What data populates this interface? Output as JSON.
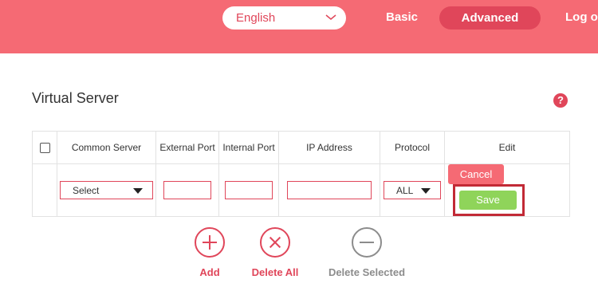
{
  "header": {
    "language": {
      "selected": "English",
      "icon": "chevron-down-icon"
    },
    "nav": {
      "basic": "Basic",
      "advanced": "Advanced",
      "logout": "Log ou"
    },
    "colors": {
      "bar": "#f56a74",
      "accent": "#e0465a"
    }
  },
  "page": {
    "title": "Virtual Server",
    "help_icon": "?"
  },
  "table": {
    "columns": [
      "Common Server",
      "External Port",
      "Internal Port",
      "IP Address",
      "Protocol",
      "Edit"
    ],
    "row": {
      "common_server": "Select",
      "external_port": "",
      "internal_port": "",
      "ip_address": "",
      "protocol": "ALL",
      "cancel_label": "Cancel",
      "save_label": "Save"
    }
  },
  "actions": {
    "add": {
      "label": "Add",
      "icon": "plus-circle-icon"
    },
    "delete_all": {
      "label": "Delete All",
      "icon": "x-circle-icon"
    },
    "delete_selected": {
      "label": "Delete Selected",
      "icon": "minus-circle-icon"
    }
  }
}
